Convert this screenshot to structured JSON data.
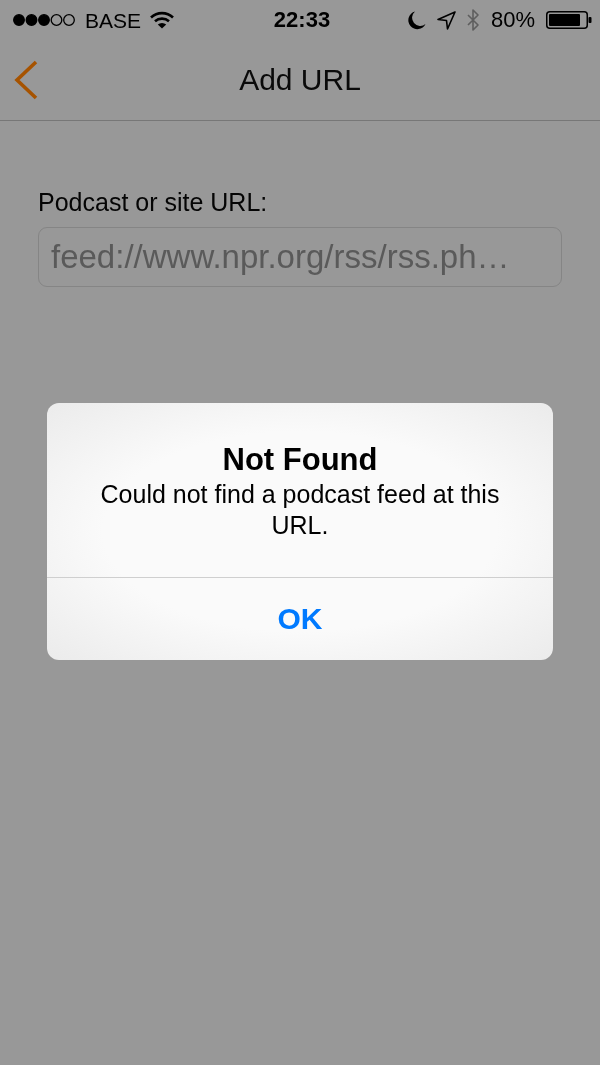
{
  "status_bar": {
    "carrier": "BASE",
    "time": "22:33",
    "battery": "80%"
  },
  "nav_bar": {
    "title": "Add URL"
  },
  "form": {
    "label": "Podcast or site URL:",
    "field": {
      "value": "feed://www.npr.org/rss/rss.ph…"
    }
  },
  "alert": {
    "title": "Not Found",
    "message": "Could not find a podcast feed at this URL.",
    "buttons": [
      "OK"
    ]
  }
}
